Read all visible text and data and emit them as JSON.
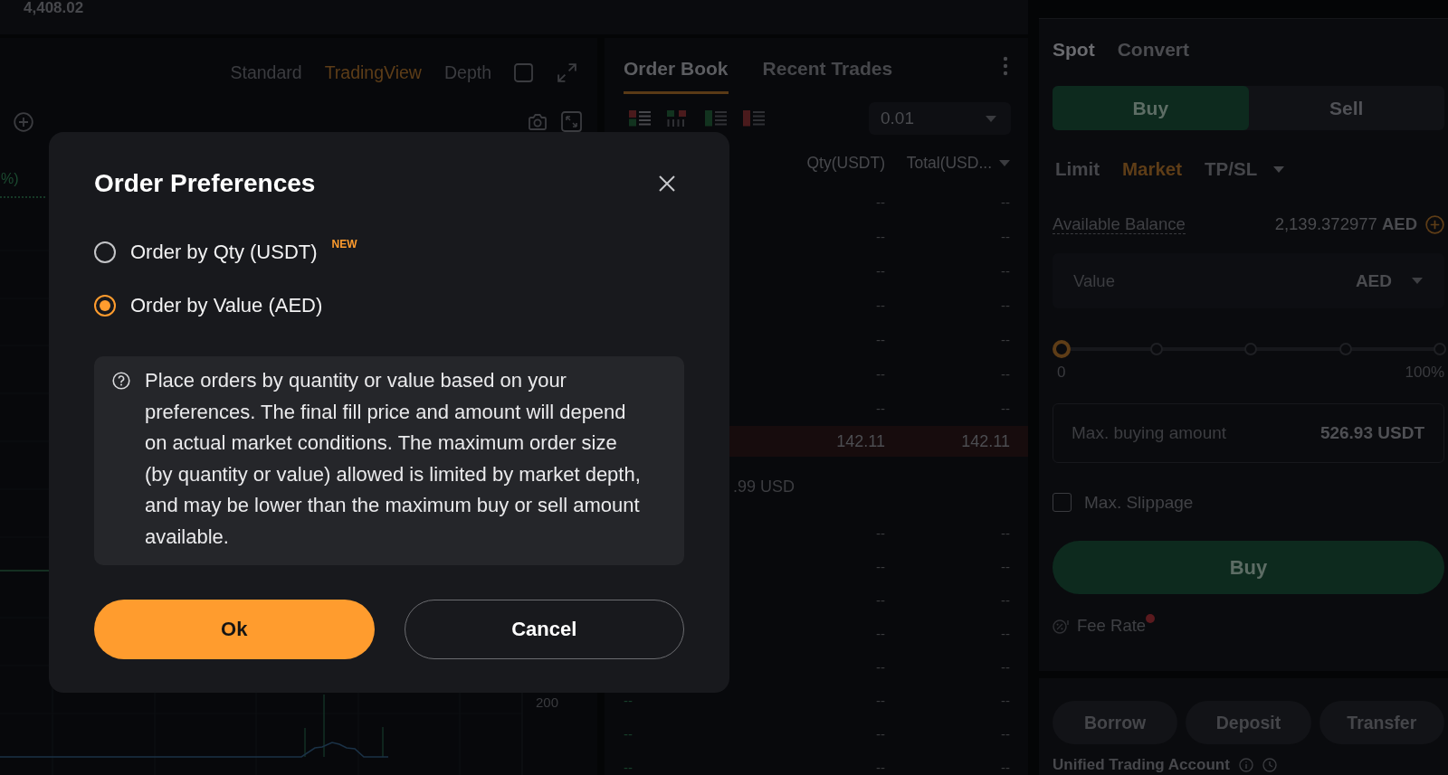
{
  "header": {
    "price": "4,408.02"
  },
  "chart": {
    "views": [
      {
        "label": "Standard",
        "selected": false
      },
      {
        "label": "TradingView",
        "selected": true
      },
      {
        "label": "Depth",
        "selected": false
      }
    ],
    "legend_fragment": "%)",
    "axis_label": "200"
  },
  "order_book": {
    "tabs": [
      {
        "label": "Order Book",
        "selected": true
      },
      {
        "label": "Recent Trades",
        "selected": false
      }
    ],
    "layouts": [
      {
        "kind": "both",
        "selected": true
      },
      {
        "kind": "columns",
        "selected": false
      },
      {
        "kind": "bids",
        "selected": false
      },
      {
        "kind": "asks",
        "selected": false
      }
    ],
    "precision": "0.01",
    "columns": [
      "Qty(USDT)",
      "Total(USD..."
    ],
    "asks": [
      {
        "qty": "--",
        "total": "--"
      },
      {
        "qty": "--",
        "total": "--"
      },
      {
        "qty": "--",
        "total": "--"
      },
      {
        "qty": "--",
        "total": "--"
      },
      {
        "qty": "--",
        "total": "--"
      },
      {
        "qty": "--",
        "total": "--"
      },
      {
        "qty": "--",
        "total": "--"
      }
    ],
    "last": {
      "qty": "142.11",
      "total": "142.11"
    },
    "mark_price": ".99 USD",
    "bids": [
      {
        "qty": "--",
        "total": "--"
      },
      {
        "qty": "--",
        "total": "--"
      },
      {
        "qty": "--",
        "total": "--"
      },
      {
        "qty": "--",
        "total": "--"
      },
      {
        "qty": "--",
        "total": "--"
      },
      {
        "price": "--",
        "qty": "--",
        "total": "--"
      },
      {
        "price": "--",
        "qty": "--",
        "total": "--"
      },
      {
        "price": "--",
        "qty": "--",
        "total": "--"
      }
    ]
  },
  "trade": {
    "modes": [
      {
        "label": "Spot",
        "selected": true
      },
      {
        "label": "Convert",
        "selected": false
      }
    ],
    "sides": [
      {
        "label": "Buy",
        "selected": true
      },
      {
        "label": "Sell",
        "selected": false
      }
    ],
    "order_types": [
      {
        "label": "Limit",
        "kind": "tab",
        "selected": false
      },
      {
        "label": "Market",
        "kind": "tab",
        "selected": true
      },
      {
        "label": "TP/SL",
        "kind": "dropdown",
        "selected": false
      }
    ],
    "balance": {
      "label": "Available Balance",
      "value": "2,139.372977 **AED**"
    },
    "value_field": {
      "placeholder": "Value",
      "unit": "AED"
    },
    "slider": {
      "level": 0,
      "min_label": "0",
      "max_label": "100%"
    },
    "max_buy": {
      "label": "Max. buying amount",
      "value": "526.93 USDT"
    },
    "slippage": {
      "label": "Max. Slippage",
      "checked": false
    },
    "submit": "Buy",
    "fee_rate": {
      "label": "Fee Rate",
      "alert": true
    },
    "actions": [
      "Borrow",
      "Deposit",
      "Transfer"
    ],
    "account_title": "Unified Trading Account"
  },
  "dialog": {
    "title": "Order Preferences",
    "options": [
      {
        "label": "Order by Qty (USDT)",
        "badge": "NEW",
        "selected": false
      },
      {
        "label": "Order by Value (AED)",
        "selected": true
      }
    ],
    "note": "Place orders by quantity or value based on your preferences. The final fill price and amount will depend on actual market conditions. The maximum order size (by quantity or value) allowed is limited by market depth, and may be lower than the maximum buy or sell amount available.",
    "buttons": [
      {
        "label": "Ok",
        "kind": "primary"
      },
      {
        "label": "Cancel",
        "kind": "secondary"
      }
    ]
  }
}
